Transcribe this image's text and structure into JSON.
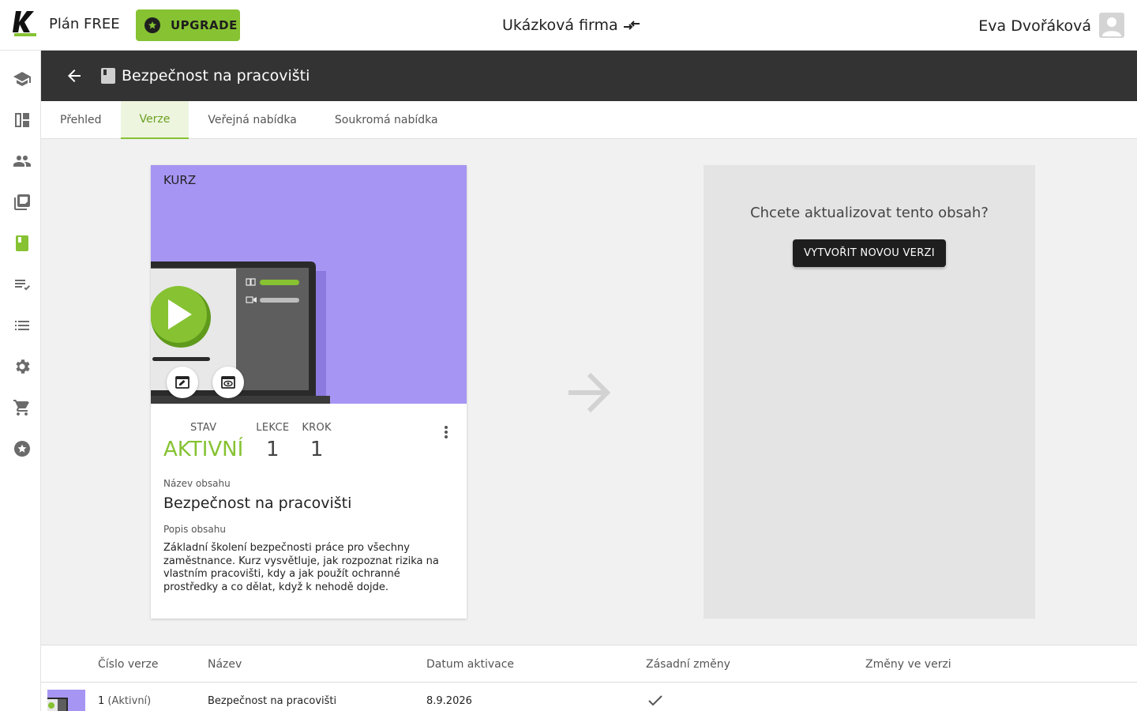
{
  "topbar": {
    "plan_label": "Plán FREE",
    "upgrade_label": "UPGRADE",
    "company_name": "Ukázková firma",
    "user_name": "Eva Dvořáková",
    "brand_color": "#86c232"
  },
  "sidebar": {
    "items": [
      {
        "icon": "graduation-cap-icon"
      },
      {
        "icon": "dashboard-icon"
      },
      {
        "icon": "people-icon"
      },
      {
        "icon": "library-icon"
      },
      {
        "icon": "book-icon",
        "active": true
      },
      {
        "icon": "playlist-check-icon"
      },
      {
        "icon": "list-icon"
      },
      {
        "icon": "settings-icon"
      },
      {
        "icon": "cart-icon"
      },
      {
        "icon": "star-badge-icon"
      }
    ]
  },
  "header": {
    "title": "Bezpečnost na pracovišti"
  },
  "tabs": [
    {
      "label": "Přehled"
    },
    {
      "label": "Verze",
      "active": true
    },
    {
      "label": "Veřejná nabídka"
    },
    {
      "label": "Soukromá nabídka"
    }
  ],
  "card": {
    "type_label": "KURZ",
    "stats": {
      "status_label": "STAV",
      "status_value": "AKTIVNÍ",
      "lessons_label": "LEKCE",
      "lessons_value": "1",
      "steps_label": "KROK",
      "steps_value": "1"
    },
    "name_label": "Název obsahu",
    "name_value": "Bezpečnost na pracovišti",
    "desc_label": "Popis obsahu",
    "desc_value": "Základní školení bezpečnosti práce pro všechny zaměstnance. Kurz vysvětluje, jak rozpoznat rizika na vlastním pracovišti, kdy a jak použít ochranné prostředky a co dělat, když k nehodě dojde.",
    "hero_color": "#a795f3"
  },
  "new_version": {
    "question": "Chcete aktualizovat tento obsah?",
    "button_label": "VYTVOŘIT NOVOU VERZI"
  },
  "versions_table": {
    "headers": [
      "Číslo verze",
      "Název",
      "Datum aktivace",
      "Zásadní změny",
      "Změny ve verzi"
    ],
    "rows": [
      {
        "number": "1",
        "status": "(Aktivní)",
        "name": "Bezpečnost na pracovišti",
        "activation_date": "8.9.2026",
        "major_changes": true,
        "changes": ""
      }
    ]
  }
}
